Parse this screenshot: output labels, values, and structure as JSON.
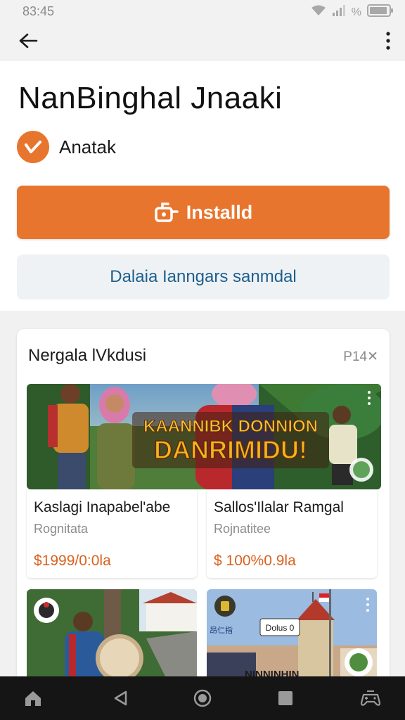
{
  "status": {
    "time": "83:45",
    "battery_text": "%",
    "icons": [
      "wifi-icon",
      "signal-icon",
      "battery-icon"
    ]
  },
  "appbar": {
    "back_icon": "arrow-left-icon",
    "menu_icon": "more-vert-icon"
  },
  "app": {
    "title": "NanBinghal Jnaaki",
    "developer": "Anatak",
    "developer_logo_icon": "check-logo-icon"
  },
  "actions": {
    "install_label": "Installd",
    "install_icon": "download-icon",
    "secondary_label": "Dalaia Ianngars sanmdal"
  },
  "section": {
    "title": "Nergala lVkdusi",
    "badge": "P14✕"
  },
  "banner": {
    "line1": "KAANNIBK DONNION",
    "line2": "DANRIMIDU!"
  },
  "items": [
    {
      "title": "Kaslagi Inapabel'abe",
      "subtitle": "Rognitata",
      "price": "$1999/0:0la"
    },
    {
      "title": "Sallos'Ilalar Ramgal",
      "subtitle": "Rojnatitee",
      "price": "$ 100%0.9la"
    }
  ],
  "tiles": [
    {
      "name": "tile-village"
    },
    {
      "name": "tile-town",
      "label_small": "Dolus 0",
      "label_left": "昂仁指",
      "label_bottom": "NINNINHIN"
    }
  ],
  "navbar": {
    "items": [
      "home-icon",
      "back-triangle-icon",
      "circle-home-icon",
      "square-recents-icon",
      "game-controller-icon"
    ]
  },
  "colors": {
    "accent": "#e8752d",
    "secondary_text": "#1e5f8e",
    "price": "#d9621f",
    "nav_bg": "#151515"
  }
}
